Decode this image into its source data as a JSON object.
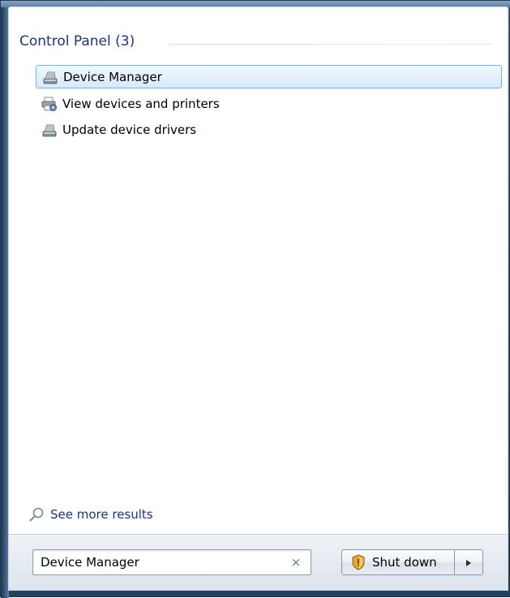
{
  "group": {
    "title": "Control Panel (3)"
  },
  "results": [
    {
      "label": "Device Manager",
      "icon": "device-manager-icon",
      "selected": true
    },
    {
      "label": "View devices and printers",
      "icon": "devices-printers-icon",
      "selected": false
    },
    {
      "label": "Update device drivers",
      "icon": "device-manager-icon",
      "selected": false
    }
  ],
  "see_more": {
    "label": "See more results",
    "icon": "search-icon"
  },
  "search": {
    "value": "Device Manager",
    "clear_symbol": "×"
  },
  "shutdown": {
    "label": "Shut down",
    "icon": "shield-icon"
  },
  "colors": {
    "accent_text": "#1e3287",
    "selection_border": "#84acdd",
    "selection_fill": "#d7e9fa"
  }
}
